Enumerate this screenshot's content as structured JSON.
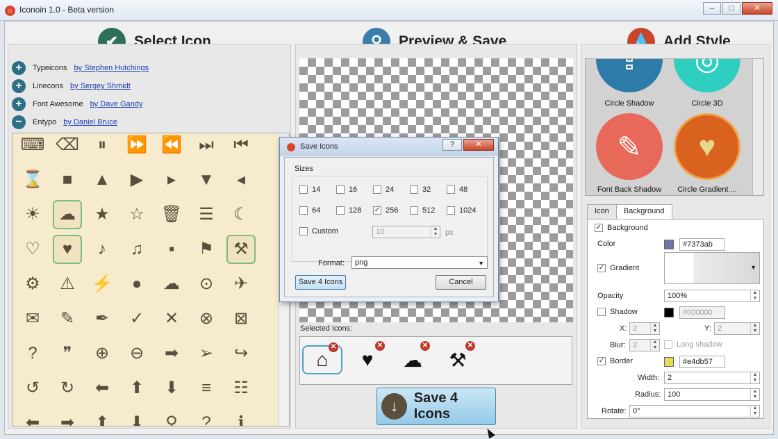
{
  "window": {
    "title": "Iconoin 1.0 - Beta version",
    "controls": [
      "–",
      "□",
      "✕"
    ]
  },
  "sections": {
    "select": {
      "title": "Select Icon",
      "icon": "check-icon",
      "color": "#2d6f5a"
    },
    "preview": {
      "title": "Preview & Save",
      "icon": "search-icon",
      "color": "#3a7ea8"
    },
    "style": {
      "title": "Add Style",
      "icon": "drop-icon",
      "color": "#c8442c"
    }
  },
  "libraries": [
    {
      "name": "Typeicons",
      "author": "by Stephen Hutchings",
      "toggle": "+"
    },
    {
      "name": "Linecons",
      "author": "by Sergey Shmidt",
      "toggle": "+"
    },
    {
      "name": "Font Awesome",
      "author": "by Dave Gandy",
      "toggle": "+"
    },
    {
      "name": "Entypo",
      "author": "by Daniel Bruce",
      "toggle": "−"
    }
  ],
  "icon_grid": [
    [
      "⌨",
      "⌫",
      "⏸",
      "⏩",
      "⏪",
      "⏭",
      "⏮"
    ],
    [
      "⌛",
      "■",
      "▲",
      "▶",
      "▸",
      "▼",
      "◂"
    ],
    [
      "☀",
      "☁",
      "★",
      "☆",
      "🗑",
      "☰",
      "☾"
    ],
    [
      "♡",
      "♥",
      "♪",
      "♫",
      "▪",
      "⚑",
      "⚒"
    ],
    [
      "⚙",
      "⚠",
      "⚡",
      "●",
      "☁",
      "⊙",
      "✈"
    ],
    [
      "✉",
      "✎",
      "✒",
      "✓",
      "✕",
      "⊗",
      "⊠"
    ],
    [
      "?",
      "❞",
      "⊕",
      "⊖",
      "➡",
      "➢",
      "↪"
    ],
    [
      "↺",
      "↻",
      "⬅",
      "⬆",
      "⬇",
      "≡",
      "☷"
    ],
    [
      "⬅",
      "➡",
      "⬆",
      "⬇",
      "⚲",
      "?",
      "ℹ"
    ]
  ],
  "selected_label": "Selected Icons:",
  "selected_icons": [
    "⌂",
    "♥",
    "☁",
    "⚒"
  ],
  "save_button": {
    "label": "Save 4 Icons",
    "icon": "↓"
  },
  "dialog": {
    "title": "Save Icons",
    "help": "?",
    "close": "✕",
    "sizes_label": "Sizes",
    "sizes": [
      {
        "value": "14",
        "checked": false
      },
      {
        "value": "16",
        "checked": false
      },
      {
        "value": "24",
        "checked": false
      },
      {
        "value": "32",
        "checked": false
      },
      {
        "value": "48",
        "checked": false
      },
      {
        "value": "64",
        "checked": false
      },
      {
        "value": "128",
        "checked": false
      },
      {
        "value": "256",
        "checked": true
      },
      {
        "value": "512",
        "checked": false
      },
      {
        "value": "1024",
        "checked": false
      }
    ],
    "custom_label": "Custom",
    "custom_value": "10",
    "custom_unit": "px",
    "format_label": "Format:",
    "format_value": "png",
    "save_label": "Save 4 Icons",
    "cancel_label": "Cancel"
  },
  "style_gallery": [
    {
      "label": "Circle Shadow",
      "color": "#2d7ca8",
      "glyph": "⇪"
    },
    {
      "label": "Circle 3D",
      "color": "#2ecfc0",
      "glyph": "◎"
    },
    {
      "label": "Font Back Shadow",
      "color": "#e8685a",
      "glyph": "✎"
    },
    {
      "label": "Circle Gradient ...",
      "color": "#d9621e",
      "glyph": "♥"
    }
  ],
  "tabs": [
    "Icon",
    "Background"
  ],
  "style": {
    "background_label": "Background",
    "background_checked": true,
    "color_label": "Color",
    "color_value": "#7373ab",
    "gradient_label": "Gradient",
    "gradient_checked": true,
    "opacity_label": "Opacity",
    "opacity_value": "100%",
    "shadow_label": "Shadow",
    "shadow_checked": false,
    "shadow_color": "#000000",
    "x_label": "X:",
    "x_value": "2",
    "y_label": "Y:",
    "y_value": "2",
    "blur_label": "Blur:",
    "blur_value": "2",
    "long_shadow_label": "Long shadow",
    "border_label": "Border",
    "border_checked": true,
    "border_color": "#e4db57",
    "width_label": "Width:",
    "width_value": "2",
    "radius_label": "Radius:",
    "radius_value": "100",
    "rotate_label": "Rotate:",
    "rotate_value": "0°"
  }
}
